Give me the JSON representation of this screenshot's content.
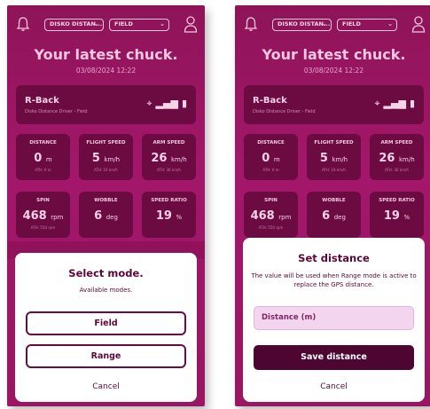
{
  "screens": [
    {
      "header": {
        "driver_dropdown": "DISKO DISTAN...",
        "mode_dropdown": "FIELD"
      },
      "title": "Your latest chuck.",
      "datetime": "03/08/2024 12:22",
      "device": {
        "name": "R-Back",
        "subtitle": "Disko Distance Driver - Field"
      },
      "stats": [
        {
          "label": "DISTANCE",
          "value": "0",
          "unit": "m",
          "ath": "ATH: 0 m"
        },
        {
          "label": "FLIGHT SPEED",
          "value": "5",
          "unit": "km/h",
          "ath": "ATH: 19 km/h"
        },
        {
          "label": "ARM SPEED",
          "value": "26",
          "unit": "km/h",
          "ath": "ATH: 36 km/h"
        },
        {
          "label": "SPIN",
          "value": "468",
          "unit": "rpm",
          "ath": "ATH: 550 rpm"
        },
        {
          "label": "WOBBLE",
          "value": "6",
          "unit": "deg",
          "ath": ""
        },
        {
          "label": "SPEED RATIO",
          "value": "19",
          "unit": "%",
          "ath": ""
        }
      ],
      "sheet": {
        "title": "Select mode.",
        "subtitle": "Available modes.",
        "option_field": "Field",
        "option_range": "Range",
        "cancel": "Cancel"
      }
    },
    {
      "header": {
        "driver_dropdown": "DISKO DISTAN...",
        "mode_dropdown": "FIELD"
      },
      "title": "Your latest chuck.",
      "datetime": "03/08/2024 12:22",
      "device": {
        "name": "R-Back",
        "subtitle": "Disko Distance Driver - Field"
      },
      "stats": [
        {
          "label": "DISTANCE",
          "value": "0",
          "unit": "m",
          "ath": "ATH: 0 m"
        },
        {
          "label": "FLIGHT SPEED",
          "value": "5",
          "unit": "km/h",
          "ath": "ATH: 19 km/h"
        },
        {
          "label": "ARM SPEED",
          "value": "26",
          "unit": "km/h",
          "ath": "ATH: 36 km/h"
        },
        {
          "label": "SPIN",
          "value": "468",
          "unit": "rpm",
          "ath": "ATH: 550 rpm"
        },
        {
          "label": "WOBBLE",
          "value": "6",
          "unit": "deg",
          "ath": ""
        },
        {
          "label": "SPEED RATIO",
          "value": "19",
          "unit": "%",
          "ath": ""
        }
      ],
      "sheet": {
        "title": "Set distance",
        "subtitle": "The value will be used when Range mode is active to replace the GPS distance.",
        "input_placeholder": "Distance (m)",
        "save_button": "Save distance",
        "cancel": "Cancel"
      }
    }
  ],
  "icons": {
    "bell": "bell-icon",
    "user": "user-icon",
    "gps": "gps-icon",
    "signal": "signal-icon",
    "battery": "battery-icon"
  },
  "colors": {
    "background": "#9a1562",
    "card": "#6b0b42",
    "title_text": "#f7c6e2",
    "button_dark": "#4d0531",
    "input_bg": "#f3d5ef"
  }
}
